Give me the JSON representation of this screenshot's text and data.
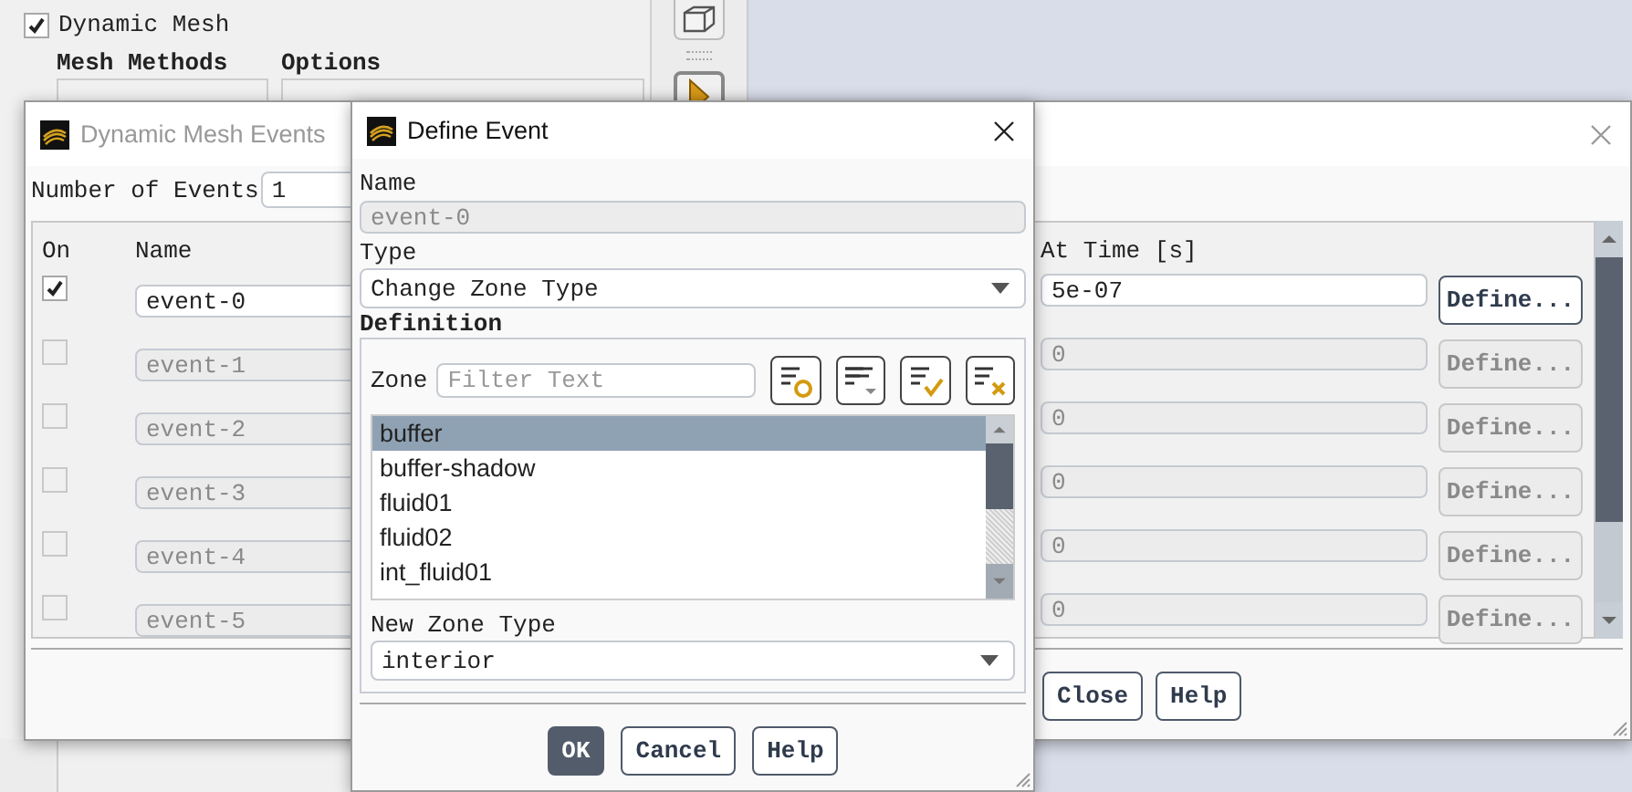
{
  "background_panel": {
    "dynamic_mesh": {
      "label": "Dynamic Mesh",
      "checked": true
    },
    "groups": [
      {
        "title": "Mesh Methods"
      },
      {
        "title": "Options"
      }
    ]
  },
  "events_window": {
    "title": "Dynamic Mesh Events",
    "active": false,
    "number_of_events_label": "Number of Events",
    "number_of_events": "1",
    "columns": [
      "On",
      "Name",
      "At Time [s]"
    ],
    "rows": [
      {
        "on": true,
        "enabled": true,
        "name": "event-0",
        "at_time": "5e-07",
        "button": "Define..."
      },
      {
        "on": false,
        "enabled": false,
        "name": "event-1",
        "at_time": "0",
        "button": "Define..."
      },
      {
        "on": false,
        "enabled": false,
        "name": "event-2",
        "at_time": "0",
        "button": "Define..."
      },
      {
        "on": false,
        "enabled": false,
        "name": "event-3",
        "at_time": "0",
        "button": "Define..."
      },
      {
        "on": false,
        "enabled": false,
        "name": "event-4",
        "at_time": "0",
        "button": "Define..."
      },
      {
        "on": false,
        "enabled": false,
        "name": "event-5",
        "at_time": "0",
        "button": "Define..."
      }
    ],
    "buttons": [
      "Close",
      "Help"
    ]
  },
  "define_event": {
    "title": "Define Event",
    "active": true,
    "name_label": "Name",
    "name": "event-0",
    "type_label": "Type",
    "type": "Change Zone Type",
    "definition_title": "Definition",
    "zone_label": "Zone",
    "filter_placeholder": "Filter Text",
    "zones": [
      {
        "label": "buffer",
        "selected": true
      },
      {
        "label": "buffer-shadow",
        "selected": false
      },
      {
        "label": "fluid01",
        "selected": false
      },
      {
        "label": "fluid02",
        "selected": false
      },
      {
        "label": "int_fluid01",
        "selected": false
      }
    ],
    "new_zone_type_label": "New Zone Type",
    "new_zone_type": "interior",
    "buttons": [
      {
        "label": "OK",
        "kind": "primary"
      },
      {
        "label": "Cancel",
        "kind": "secondary"
      },
      {
        "label": "Help",
        "kind": "secondary"
      }
    ]
  }
}
